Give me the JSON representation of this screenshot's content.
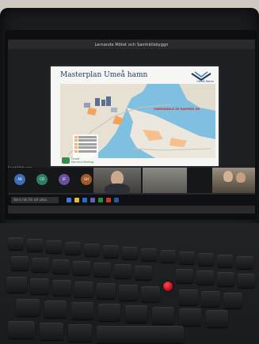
{
  "meeting": {
    "window_title": "Lernande Mötet och Samhällsbyggn"
  },
  "slide": {
    "title": "Masterplan Umeå hamn",
    "logo_text": "Umeå Hamn",
    "map_caption": "VINDHANDLE ÄR RAMMER OR",
    "bottom_logo_text": "Umeå\nKommunföretag"
  },
  "presenter": {
    "label": "Samhällsbyggn"
  },
  "participants": [
    {
      "initials": "AB",
      "color": "#3a6fb4"
    },
    {
      "initials": "CD",
      "color": "#2e7e64"
    },
    {
      "initials": "EF",
      "color": "#6a4fa0"
    },
    {
      "initials": "GH",
      "color": "#a05a2c"
    }
  ],
  "taskbar": {
    "search_placeholder": "Skriv här för att söka"
  },
  "colors": {
    "water": "#7fbfe0",
    "land": "#e7e1d4",
    "trackpoint": "#d3121f",
    "keyboard": "#1b1c1e"
  }
}
